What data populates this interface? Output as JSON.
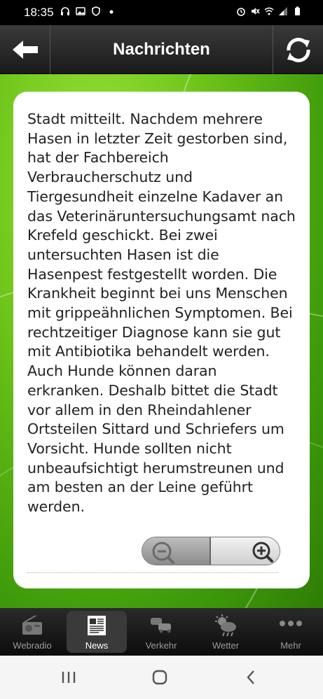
{
  "status_bar": {
    "time": "18:35",
    "left_icons": [
      "headset-icon",
      "image-icon",
      "shield-icon",
      "dot-icon"
    ],
    "right_icons": [
      "alarm-icon",
      "mute-icon",
      "wifi-icon",
      "signal-icon",
      "battery-icon"
    ]
  },
  "header": {
    "title": "Nachrichten",
    "back_icon": "arrow-left-icon",
    "refresh_icon": "refresh-icon"
  },
  "article": {
    "text": "Stadt mitteilt. Nachdem mehrere Hasen in letzter Zeit gestorben sind, hat der Fachbereich Verbraucherschutz und Tiergesundheit einzelne Kadaver an das Veterinäruntersuchungsamt nach Krefeld geschickt. Bei zwei untersuchten Hasen ist die Hasenpest festgestellt worden. Die Krankheit beginnt bei uns Menschen mit grippeähnlichen Symptomen. Bei rechtzeitiger Diagnose kann sie gut mit Antibiotika behandelt werden. Auch Hunde können daran erkranken. Deshalb bittet die Stadt vor allem in den Rheindahlener Ortsteilen Sittard und Schriefers um Vorsicht. Hunde sollten nicht unbeaufsichtigt herumstreunen und am besten an der Leine geführt werden."
  },
  "zoom": {
    "out_icon": "zoom-out-icon",
    "in_icon": "zoom-in-icon"
  },
  "tabs": [
    {
      "label": "Webradio",
      "icon": "radio-icon",
      "active": false
    },
    {
      "label": "News",
      "icon": "newspaper-icon",
      "active": true
    },
    {
      "label": "Verkehr",
      "icon": "traffic-icon",
      "active": false
    },
    {
      "label": "Wetter",
      "icon": "weather-icon",
      "active": false
    },
    {
      "label": "Mehr",
      "icon": "more-icon",
      "active": false
    }
  ],
  "system_nav": [
    "recents-icon",
    "home-icon",
    "back-icon"
  ],
  "colors": {
    "accent_green": "#6fc51a",
    "header_dark": "#2a2a2a"
  }
}
